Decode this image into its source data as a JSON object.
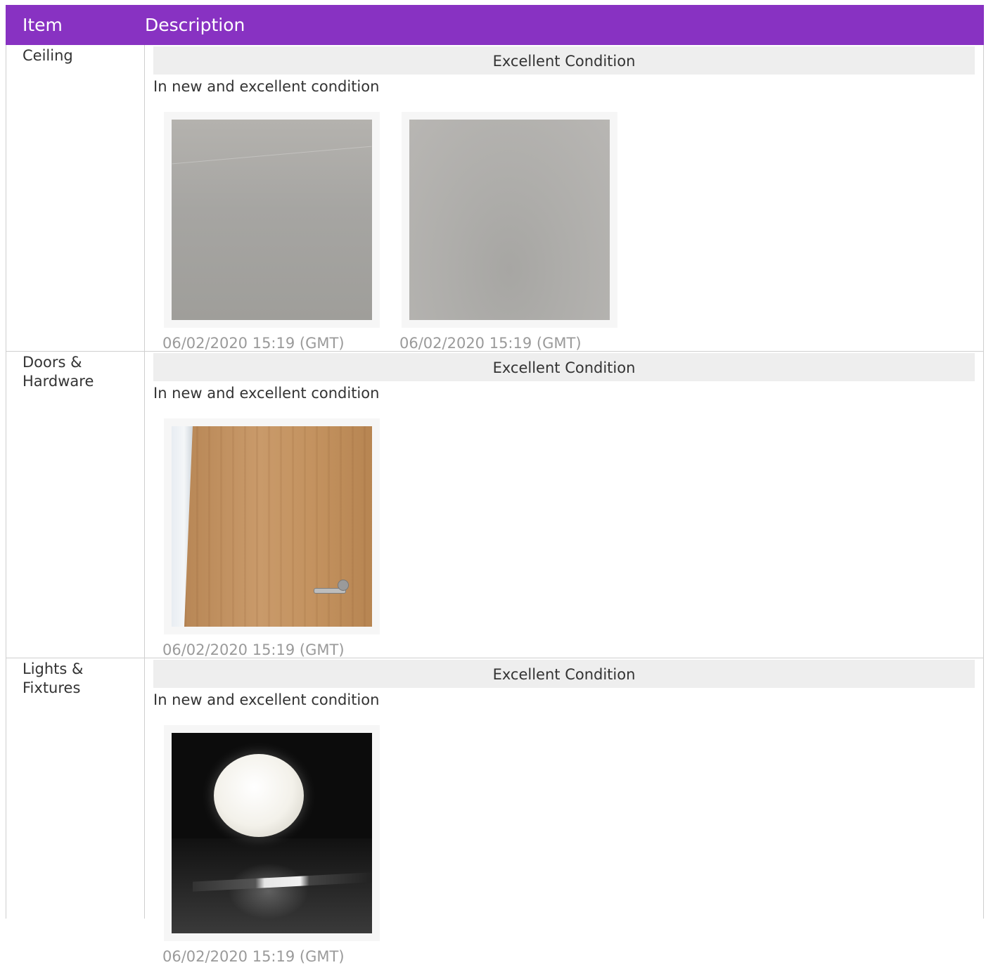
{
  "table": {
    "headers": {
      "item": "Item",
      "description": "Description"
    },
    "rows": [
      {
        "item": "Ceiling",
        "condition": "Excellent Condition",
        "description": "In new and excellent condition",
        "photos": [
          {
            "timestamp": "06/02/2020 15:19 (GMT)"
          },
          {
            "timestamp": "06/02/2020 15:19 (GMT)"
          }
        ]
      },
      {
        "item": "Doors & Hardware",
        "condition": "Excellent Condition",
        "description": "In new and excellent condition",
        "photos": [
          {
            "timestamp": "06/02/2020 15:19 (GMT)"
          }
        ]
      },
      {
        "item": "Lights & Fixtures",
        "condition": "Excellent Condition",
        "description": "In new and excellent condition",
        "photos": [
          {
            "timestamp": "06/02/2020 15:19 (GMT)"
          }
        ]
      }
    ]
  },
  "colors": {
    "header_bg": "#8832c2",
    "condition_bg": "#eeeeee",
    "timestamp_text": "#9a9a9a"
  }
}
